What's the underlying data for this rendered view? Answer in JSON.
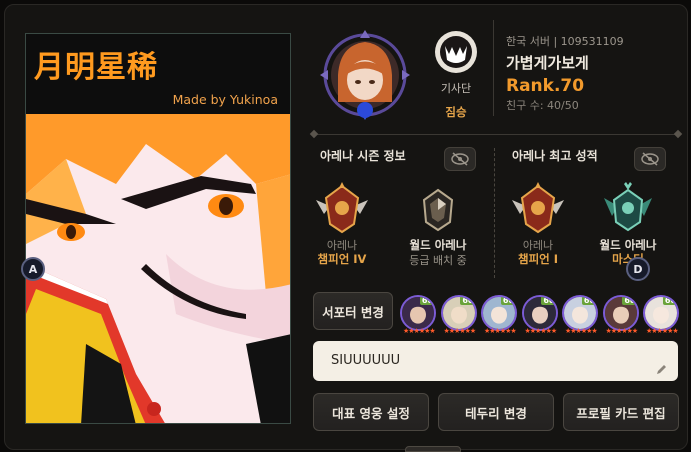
{
  "card": {
    "title": "月明星稀",
    "subtitle": "Made by Yukinoa",
    "badge_left": "A",
    "badge_right": "D"
  },
  "profile": {
    "guild_label": "기사단",
    "guild_name": "짐승",
    "server": "한국 서버 | 109531109",
    "nickname": "가볍게가보게",
    "rank": "Rank.70",
    "friends": "친구 수: 40/50"
  },
  "season": {
    "title": "아레나 시즌 정보",
    "arena_caption": "아레나",
    "arena_tier": "챔피언 IV",
    "world_caption": "월드 아레나",
    "world_tier": "등급 배치 중"
  },
  "best": {
    "title": "아레나 최고 성적",
    "arena_caption": "아레나",
    "arena_tier": "챔피언 I",
    "world_caption": "월드 아레나",
    "world_tier": "마스터"
  },
  "supporters": {
    "button": "서포터 변경",
    "heroes": [
      {
        "level": "60",
        "color": "#3b2a4a",
        "skin": "#e6c6b0"
      },
      {
        "level": "60",
        "color": "#d8cfb8",
        "skin": "#f0ddc8"
      },
      {
        "level": "60",
        "color": "#9fb6d0",
        "skin": "#f3e4d8"
      },
      {
        "level": "60",
        "color": "#2d2a3a",
        "skin": "#e8cfc0"
      },
      {
        "level": "60",
        "color": "#c8d0e0",
        "skin": "#f4e6dc"
      },
      {
        "level": "60",
        "color": "#5a3a3a",
        "skin": "#e9cdb8"
      },
      {
        "level": "60",
        "color": "#e8e2dc",
        "skin": "#f6e8de"
      }
    ]
  },
  "status_message": "SIUUUUUU",
  "actions": {
    "rep_hero": "대표 영웅 설정",
    "border": "테두리 변경",
    "profile_card": "프로필 카드 편집"
  }
}
